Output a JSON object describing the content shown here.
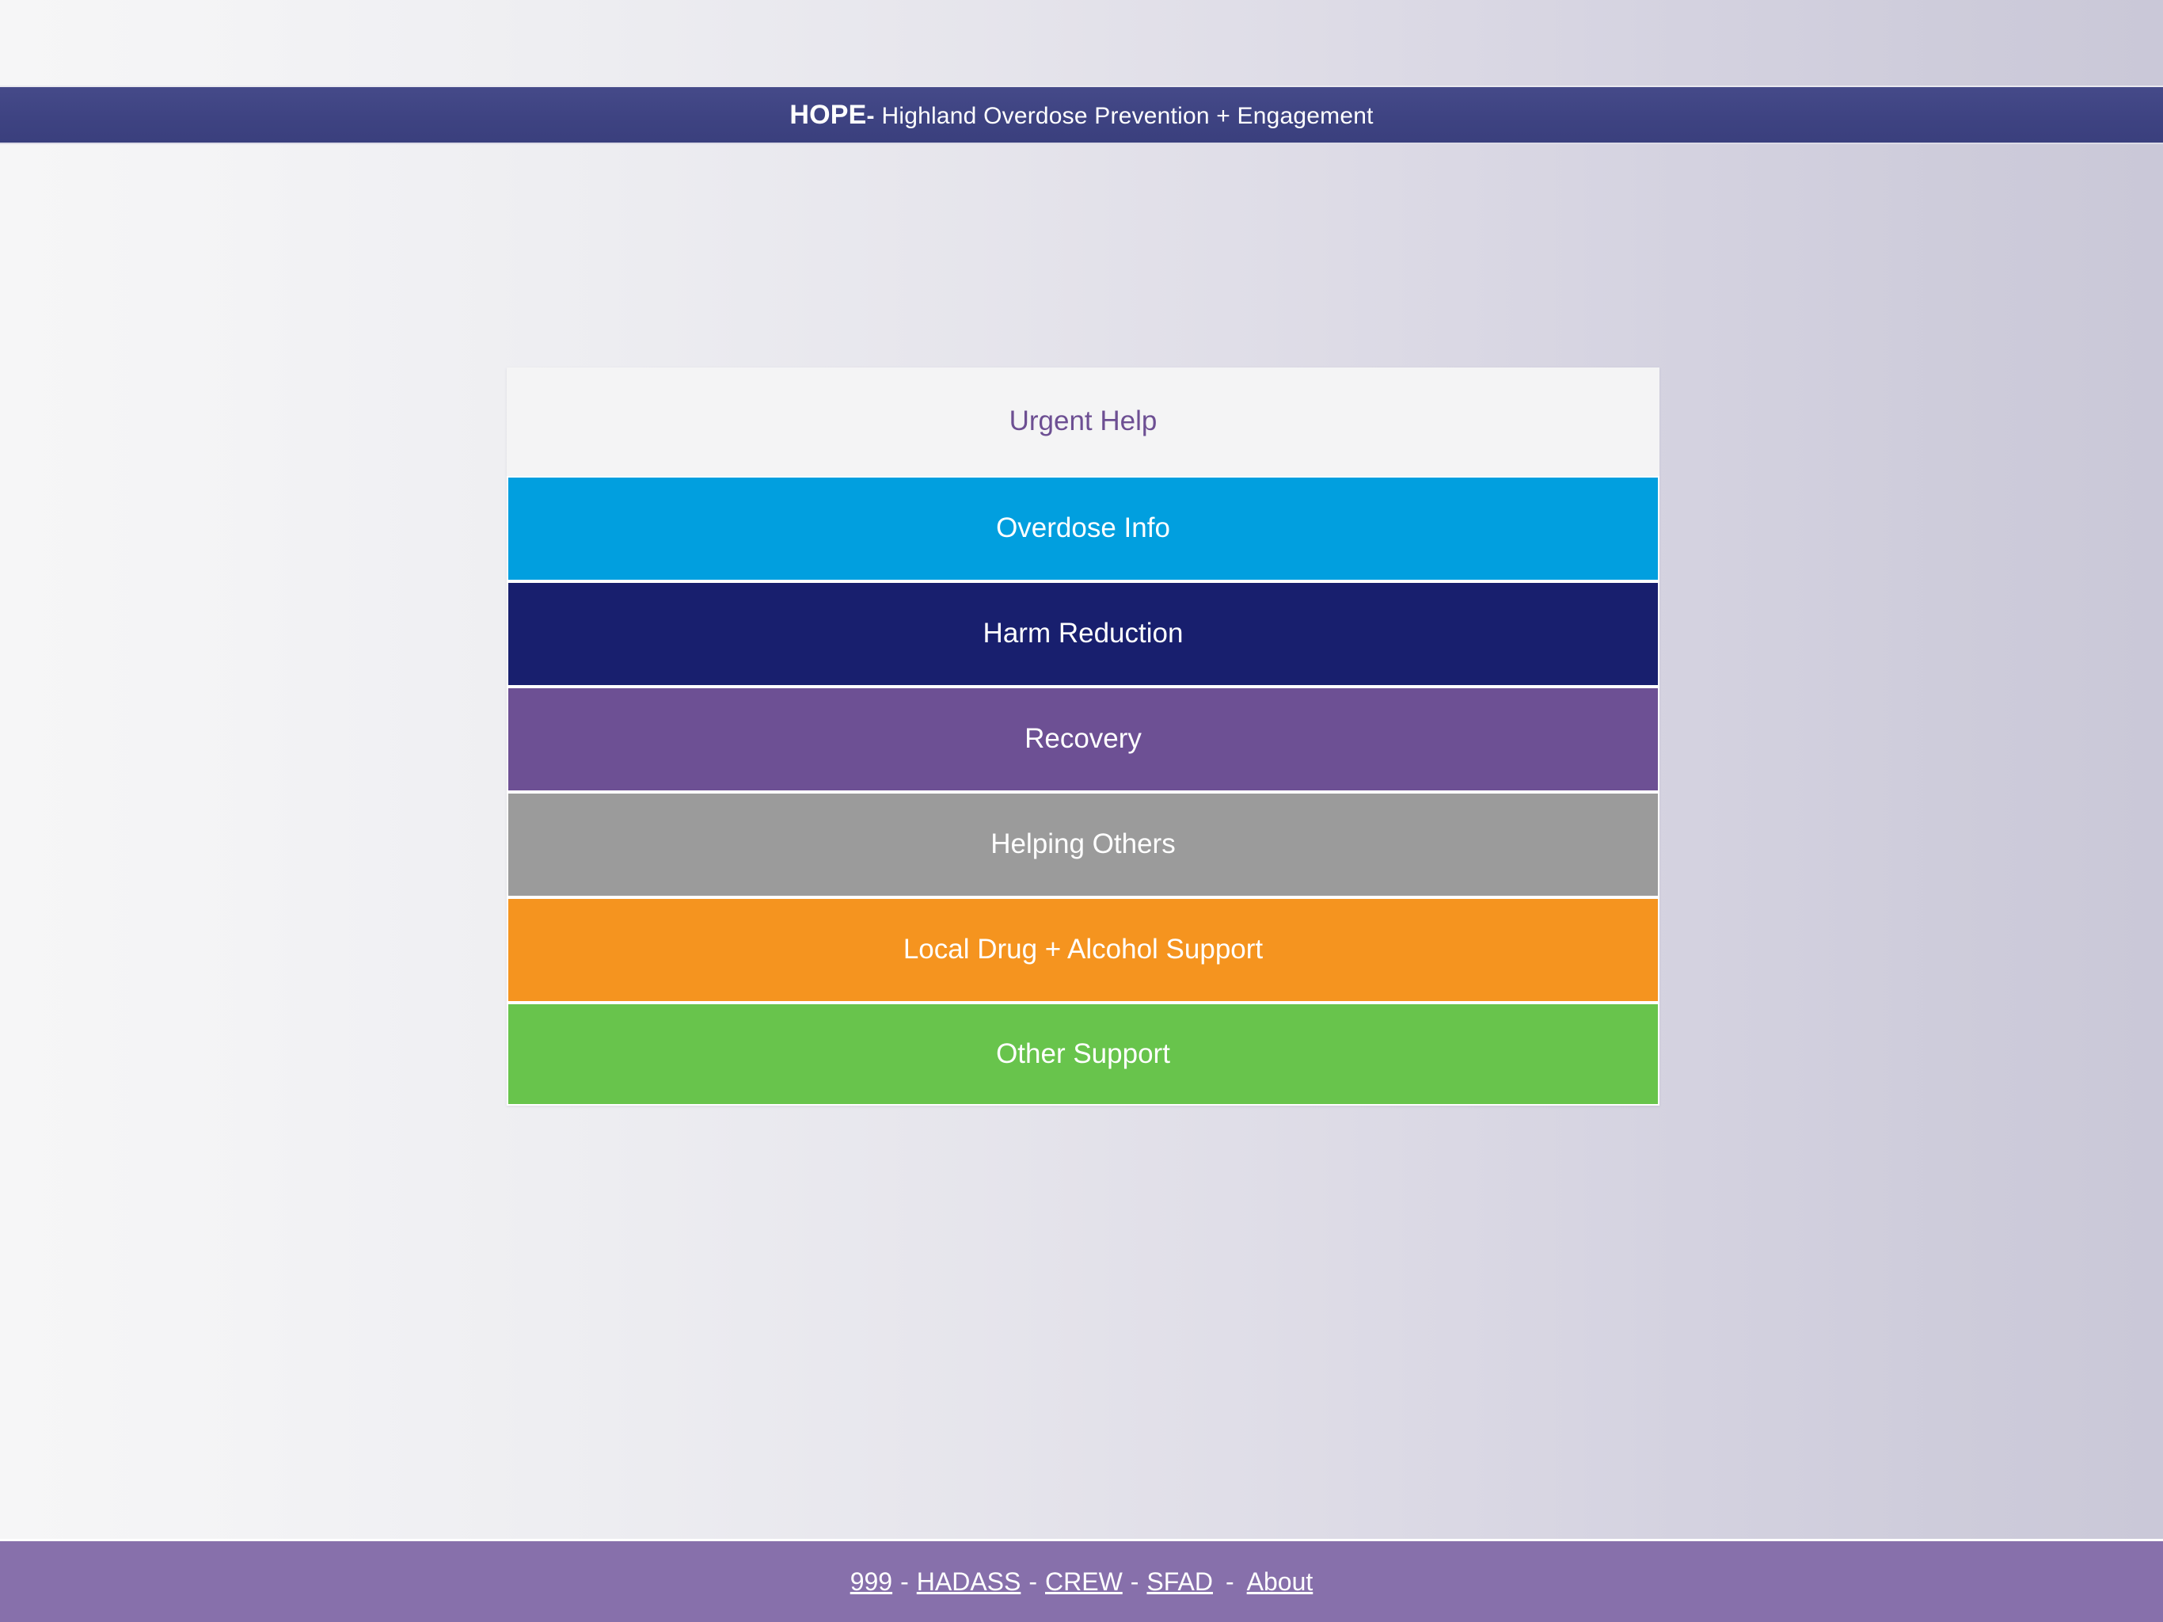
{
  "header": {
    "brand": "HOPE",
    "dash": "-",
    "subtitle": "Highland Overdose Prevention + Engagement",
    "background_color": "#3f4484",
    "text_color": "#ffffff"
  },
  "page": {
    "background_gradient_from": "#f6f6f7",
    "background_gradient_to": "#cac8d8"
  },
  "menu": {
    "items": [
      {
        "label": "Urgent Help",
        "bg": "#f4f4f5",
        "fg": "#6d4f93"
      },
      {
        "label": "Overdose Info",
        "bg": "#019fdf",
        "fg": "#ffffff"
      },
      {
        "label": "Harm Reduction",
        "bg": "#181f6e",
        "fg": "#ffffff"
      },
      {
        "label": "Recovery",
        "bg": "#6d5094",
        "fg": "#ffffff"
      },
      {
        "label": "Helping Others",
        "bg": "#9b9b9b",
        "fg": "#ffffff"
      },
      {
        "label": "Local Drug + Alcohol Support",
        "bg": "#f5941f",
        "fg": "#ffffff"
      },
      {
        "label": "Other Support",
        "bg": "#68c44c",
        "fg": "#ffffff"
      }
    ]
  },
  "footer": {
    "background_color": "#8770ab",
    "text_color": "#ffffff",
    "links": [
      {
        "label": "999"
      },
      {
        "label": "HADASS"
      },
      {
        "label": "CREW"
      },
      {
        "label": "SFAD"
      },
      {
        "label": "About"
      }
    ],
    "separator": "-"
  }
}
